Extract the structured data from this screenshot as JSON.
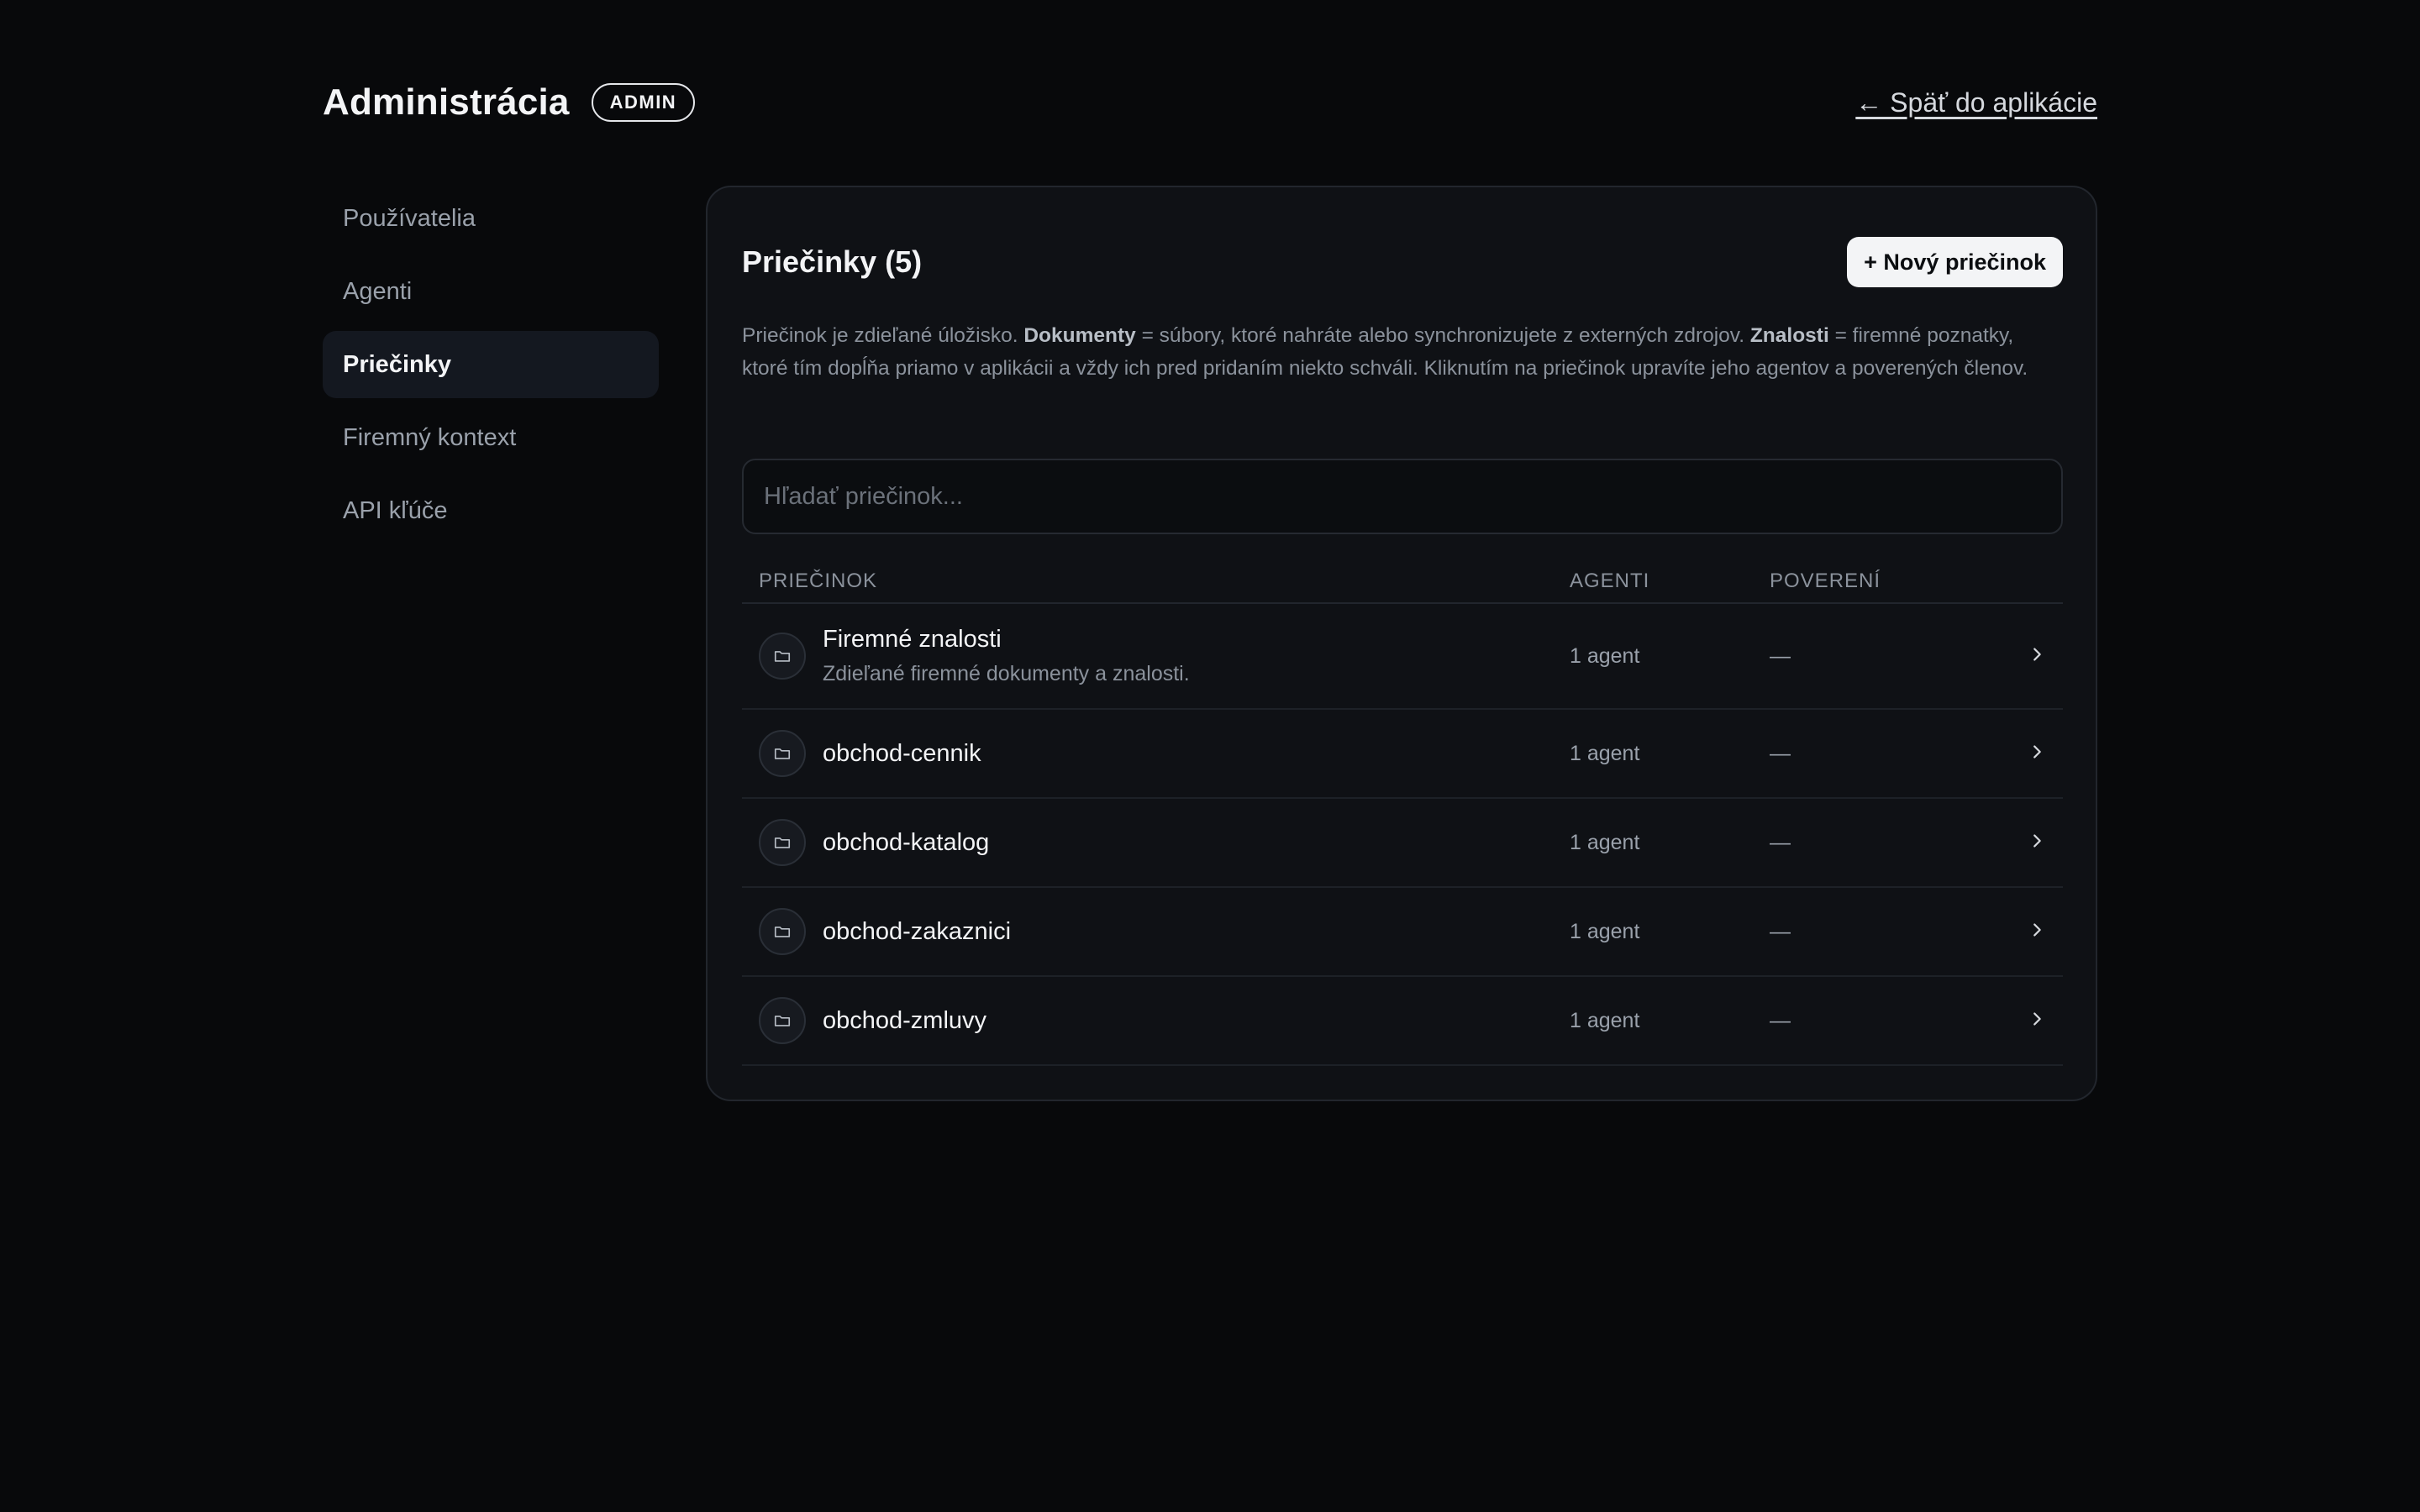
{
  "header": {
    "title": "Administrácia",
    "badge": "ADMIN",
    "back_link": "← Späť do aplikácie"
  },
  "sidebar": {
    "items": [
      {
        "label": "Používatelia"
      },
      {
        "label": "Agenti"
      },
      {
        "label": "Priečinky",
        "active": true
      },
      {
        "label": "Firemný kontext"
      },
      {
        "label": "API kľúče"
      }
    ]
  },
  "panel": {
    "title": "Priečinky (5)",
    "new_button": "+ Nový priečinok",
    "description": {
      "part1": "Priečinok je zdieľané úložisko. ",
      "bold1": "Dokumenty",
      "part2": " = súbory, ktoré nahráte alebo synchronizujete z externých zdrojov. ",
      "bold2": "Znalosti",
      "part3": " = firemné poznatky, ktoré tím dopĺňa priamo v aplikácii a vždy ich pred pridaním niekto schváli. Kliknutím na priečinok upravíte jeho agentov a poverených členov."
    },
    "search_placeholder": "Hľadať priečinok...",
    "columns": {
      "name": "PRIEČINOK",
      "agents": "AGENTI",
      "delegated": "POVERENÍ"
    },
    "rows": [
      {
        "name": "Firemné znalosti",
        "subtitle": "Zdieľané firemné dokumenty a znalosti.",
        "agents": "1 agent",
        "delegated": "—"
      },
      {
        "name": "obchod-cennik",
        "agents": "1 agent",
        "delegated": "—"
      },
      {
        "name": "obchod-katalog",
        "agents": "1 agent",
        "delegated": "—"
      },
      {
        "name": "obchod-zakaznici",
        "agents": "1 agent",
        "delegated": "—"
      },
      {
        "name": "obchod-zmluvy",
        "agents": "1 agent",
        "delegated": "—"
      }
    ]
  },
  "icons": {
    "row_icon": "folder-icon",
    "row_action": "chevron-right-icon"
  },
  "colors": {
    "background": "#08090b",
    "panel": "#0f1115",
    "active_item": "#141820",
    "button_bg": "#f3f4f6"
  }
}
